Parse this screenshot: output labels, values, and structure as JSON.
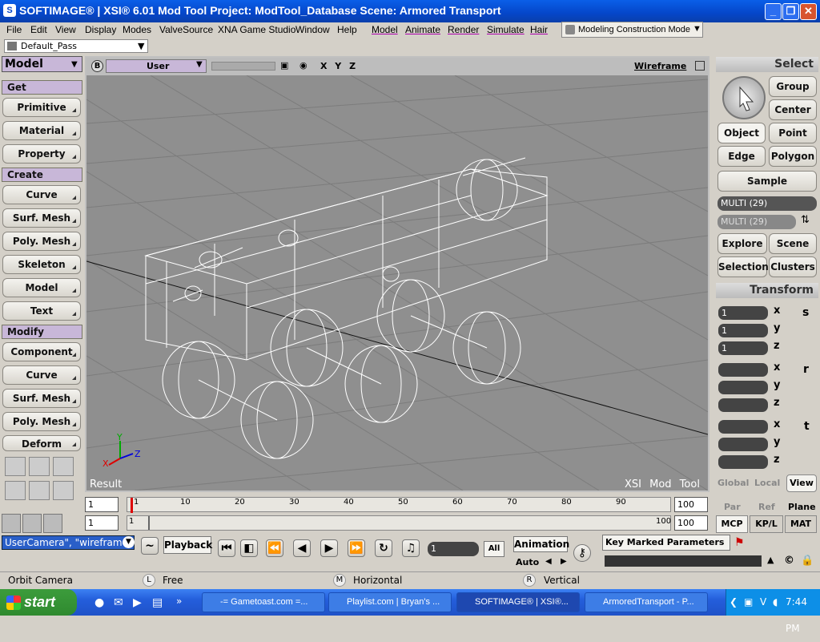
{
  "window": {
    "title": "SOFTIMAGE® | XSI® 6.01 Mod Tool Project: ModTool_Database     Scene: Armored Transport"
  },
  "menubar": {
    "items": [
      "File",
      "Edit",
      "View",
      "Display",
      "Modes",
      "ValveSource",
      "XNA Game Studio",
      "Window",
      "Help"
    ],
    "modules": [
      "Model",
      "Animate",
      "Render",
      "Simulate",
      "Hair"
    ],
    "mode": "Modeling Construction Mode"
  },
  "pass": {
    "selected": "Default_Pass"
  },
  "left_panel": {
    "title": "Model",
    "sections": [
      {
        "header": "Get",
        "buttons": [
          "Primitive",
          "Material",
          "Property"
        ]
      },
      {
        "header": "Create",
        "buttons": [
          "Curve",
          "Surf. Mesh",
          "Poly. Mesh",
          "Skeleton",
          "Model",
          "Text"
        ]
      },
      {
        "header": "Modify",
        "buttons": [
          "Component",
          "Curve",
          "Surf. Mesh",
          "Poly. Mesh",
          "Deform"
        ]
      }
    ]
  },
  "viewport": {
    "camera": "User",
    "axes": "X Y Z",
    "display_mode": "Wireframe",
    "corner_label": "Result",
    "watermark": "XSI Mod Tool",
    "axis_icon": {
      "x": "X",
      "y": "Y",
      "z": "Z"
    }
  },
  "right_panel": {
    "select_header": "Select",
    "select_buttons": [
      "Group",
      "Center",
      "Object",
      "Point",
      "Edge",
      "Polygon",
      "Sample"
    ],
    "multi1": "MULTI (29)",
    "multi2": "MULTI (29)",
    "nav_buttons": [
      "Explore",
      "Scene",
      "Selection",
      "Clusters"
    ],
    "transform_header": "Transform",
    "scale": {
      "x": "1",
      "y": "1",
      "z": "1"
    },
    "axis_labels": [
      "x",
      "y",
      "z"
    ],
    "side_icons": [
      "s",
      "r",
      "t"
    ],
    "ref_modes": [
      "Global",
      "Local",
      "View"
    ],
    "ref_modes2": [
      "Par",
      "Ref",
      "Plane"
    ],
    "tabs": [
      "MCP",
      "KP/L",
      "MAT"
    ]
  },
  "timeline": {
    "start_top": "1",
    "start_bottom": "1",
    "ticks": [
      "1",
      "10",
      "20",
      "30",
      "40",
      "50",
      "60",
      "70",
      "80",
      "90"
    ],
    "end_marker": "100",
    "end_top": "100",
    "end_bottom": "100",
    "lower_start": "1"
  },
  "controls": {
    "command_text": "UserCamera\", \"wireframe\"",
    "playback_label": "Playback",
    "frame_value": "1",
    "all_label": "All",
    "animation_label": "Animation",
    "auto_label": "Auto",
    "key_marked_label": "Key Marked Parameters"
  },
  "status": {
    "tool": "Orbit Camera",
    "left_mouse": "Free",
    "middle_mouse": "Horizontal",
    "right_mouse": "Vertical",
    "L": "L",
    "M": "M",
    "R": "R"
  },
  "taskbar": {
    "start": "start",
    "tasks": [
      "-= Gametoast.com =...",
      "Playlist.com | Bryan's ...",
      "SOFTIMAGE® | XSI®...",
      "ArmoredTransport - P..."
    ],
    "time": "7:44 PM"
  }
}
